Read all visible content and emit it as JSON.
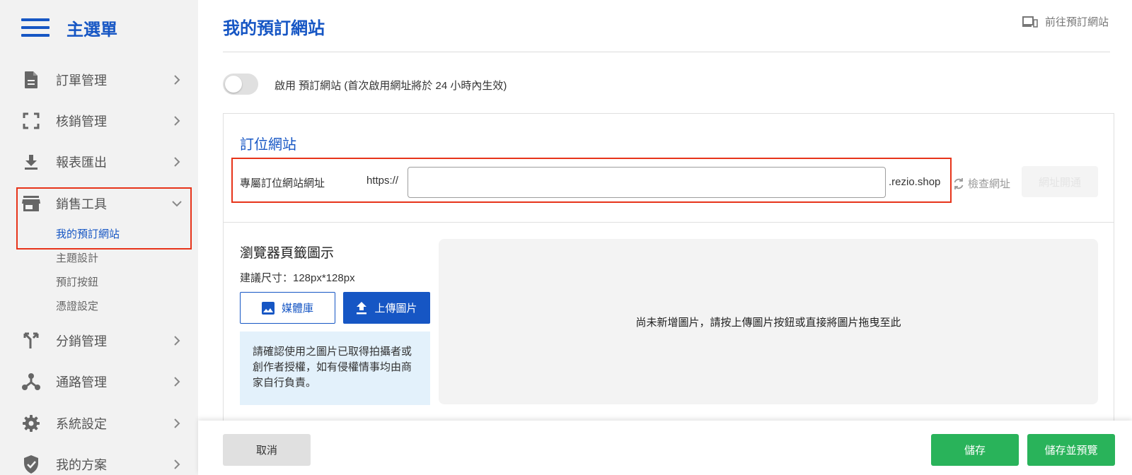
{
  "sidebar": {
    "title": "主選單",
    "items": [
      {
        "label": "訂單管理",
        "icon": "document-icon"
      },
      {
        "label": "核銷管理",
        "icon": "scan-frame-icon"
      },
      {
        "label": "報表匯出",
        "icon": "download-icon"
      },
      {
        "label": "銷售工具",
        "icon": "store-icon",
        "expanded": true,
        "subitems": [
          {
            "label": "我的預訂網站",
            "active": true
          },
          {
            "label": "主題設計"
          },
          {
            "label": "預訂按鈕"
          },
          {
            "label": "憑證設定"
          }
        ]
      },
      {
        "label": "分銷管理",
        "icon": "merge-arrows-icon"
      },
      {
        "label": "通路管理",
        "icon": "hub-icon"
      },
      {
        "label": "系統設定",
        "icon": "gear-icon"
      },
      {
        "label": "我的方案",
        "icon": "shield-check-icon"
      }
    ]
  },
  "header": {
    "title": "我的預訂網站",
    "goto_label": "前往預訂網站"
  },
  "toggle": {
    "enabled": false,
    "label": "啟用 預訂網站 (首次啟用網址將於 24 小時內生效)"
  },
  "booking_site": {
    "section_title": "訂位網站",
    "url_label": "專屬訂位網站網址",
    "url_prefix": "https://",
    "url_value": "",
    "url_suffix": ".rezio.shop",
    "check_label": "檢查網址",
    "disabled_button_label": "網址開通"
  },
  "favicon": {
    "title": "瀏覽器頁籤圖示",
    "size_hint": "建議尺寸：128px*128px",
    "media_button": "媒體庫",
    "upload_button": "上傳圖片",
    "notice": "請確認使用之圖片已取得拍攝者或創作者授權，如有侵權情事均由商家自行負責。",
    "dropzone_text": "尚未新增圖片，請按上傳圖片按鈕或直接將圖片拖曳至此"
  },
  "footer": {
    "cancel": "取消",
    "save": "儲存",
    "save_preview": "儲存並預覽"
  },
  "colors": {
    "primary": "#1656c4",
    "success": "#29b35a",
    "highlight": "#e7341a",
    "notice_bg": "#e3f1fb"
  }
}
